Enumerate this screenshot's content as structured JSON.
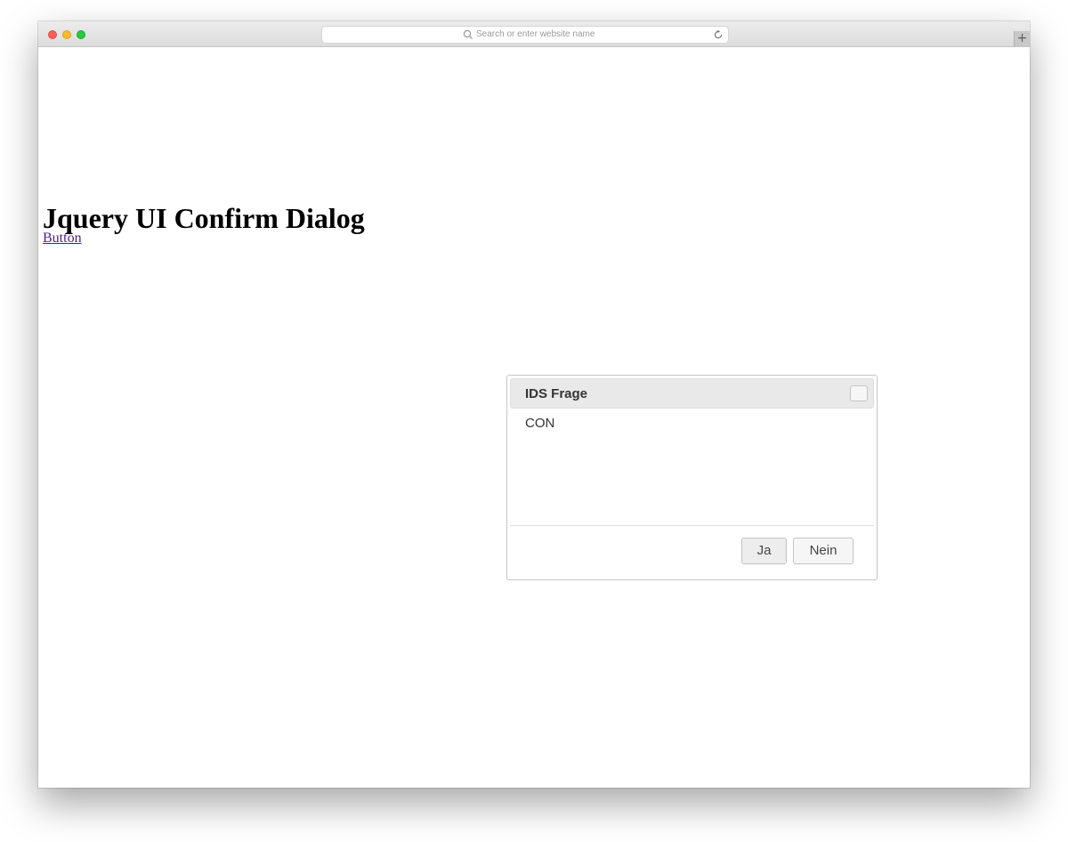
{
  "browser": {
    "address_placeholder": "Search or enter website name",
    "new_tab_label": "+"
  },
  "page": {
    "title": "Jquery UI Confirm Dialog",
    "link_label": "Button"
  },
  "dialog": {
    "title": "IDS Frage",
    "message": "CON",
    "buttons": {
      "yes": "Ja",
      "no": "Nein"
    }
  },
  "colors": {
    "link": "#551a8b",
    "dialog_header_bg": "#e9e9e9",
    "button_bg": "#f6f6f6"
  }
}
